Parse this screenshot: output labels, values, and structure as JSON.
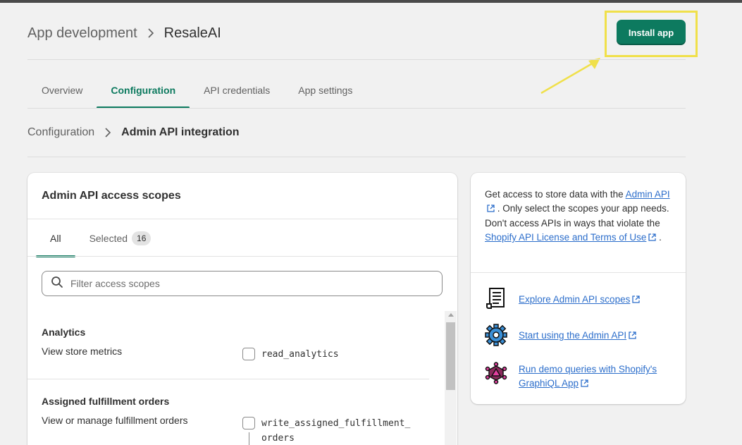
{
  "header": {
    "breadcrumb_parent": "App development",
    "title": "ResaleAI",
    "install_button": "Install app"
  },
  "tabs": [
    {
      "label": "Overview"
    },
    {
      "label": "Configuration"
    },
    {
      "label": "API credentials"
    },
    {
      "label": "App settings"
    }
  ],
  "sub_breadcrumb": {
    "parent": "Configuration",
    "current": "Admin API integration"
  },
  "scopes_card": {
    "title": "Admin API access scopes",
    "tab_all": "All",
    "tab_selected": "Selected",
    "selected_count": "16",
    "filter_placeholder": "Filter access scopes",
    "sections": [
      {
        "title": "Analytics",
        "description": "View store metrics",
        "scope": "read_analytics"
      },
      {
        "title": "Assigned fulfillment orders",
        "description": "View or manage fulfillment orders",
        "scope_line1": "write_assigned_fulfillment_",
        "scope_line2": "orders"
      }
    ]
  },
  "info_card": {
    "text_1": "Get access to store data with the ",
    "link_admin_api": "Admin API",
    "text_2": " . Only select the scopes your app needs. Don't access APIs in ways that violate the ",
    "link_license": "Shopify API License and Terms of Use",
    "text_3": " .",
    "resources": [
      {
        "label": "Explore Admin API scopes",
        "icon": "scroll-icon"
      },
      {
        "label": "Start using the Admin API",
        "icon": "gear-icon"
      },
      {
        "label": "Run demo queries with Shopify's GraphiQL App",
        "icon": "graphiql-icon"
      }
    ]
  },
  "colors": {
    "primary_green": "#0d7a5f",
    "link_blue": "#2c6ecb",
    "annotation_yellow": "#f0e04a"
  }
}
